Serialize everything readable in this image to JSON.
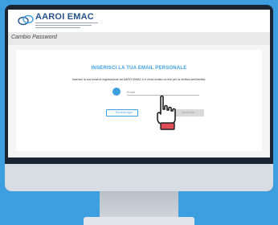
{
  "window": {
    "title": "Cambio Password"
  },
  "header": {
    "logo_text": "AAROI EMAC",
    "logo_icon": "aaroi-logo-icon"
  },
  "form": {
    "heading": "INSERISCI LA TUA EMAIL PERSONALE",
    "instructions": "Inserisci la tua email di registrazione ad AAROI EMAC e ti verrà inviato un link per la verifica dell'identità.",
    "email_placeholder": "Email",
    "email_icon": "user-circle-icon",
    "back_label": "← Torna al login",
    "confirm_label": "Conferma →"
  },
  "colors": {
    "accent": "#3d9ee0",
    "brand_dark": "#27538a",
    "pointer_cuff": "#e24a57",
    "monitor_frame": "#1a2433"
  },
  "icons": {
    "pointer": "pointing-hand-icon"
  }
}
